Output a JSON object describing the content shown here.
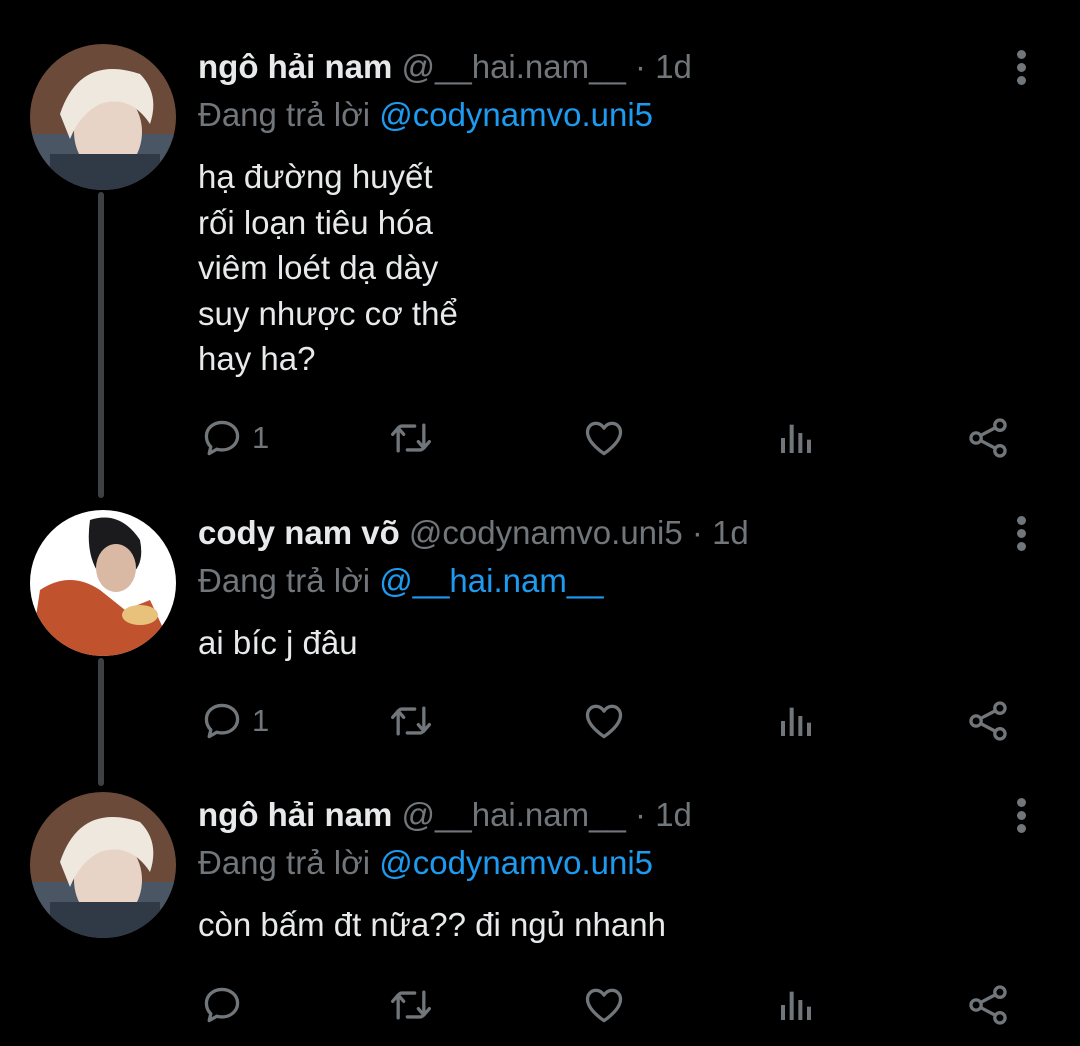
{
  "tweets": [
    {
      "name": "ngô hải nam",
      "handle": "@__hai.nam__",
      "separator": "·",
      "time": "1d",
      "replying_prefix": "Đang trả lời",
      "replying_to": "@codynamvo.uni5",
      "lines": [
        "hạ đường huyết",
        "rối loạn tiêu hóa",
        "viêm loét dạ dày",
        "suy nhược cơ thể",
        "hay ha?"
      ],
      "reply_count": "1",
      "avatar": "blond-hair-man-avatar"
    },
    {
      "name": "cody nam võ",
      "handle": "@codynamvo.uni5",
      "separator": "·",
      "time": "1d",
      "replying_prefix": "Đang trả lời",
      "replying_to": "@__hai.nam__",
      "lines": [
        "ai bíc j đâu"
      ],
      "reply_count": "1",
      "avatar": "dark-hair-man-eating-avatar"
    },
    {
      "name": "ngô hải nam",
      "handle": "@__hai.nam__",
      "separator": "·",
      "time": "1d",
      "replying_prefix": "Đang trả lời",
      "replying_to": "@codynamvo.uni5",
      "lines": [
        "còn bấm đt nữa?? đi ngủ nhanh"
      ],
      "reply_count": "",
      "avatar": "blond-hair-man-avatar"
    }
  ],
  "icons": {
    "reply": "reply-icon",
    "retweet": "retweet-icon",
    "like": "heart-icon",
    "views": "views-icon",
    "share": "share-icon",
    "more": "more-vertical-icon"
  },
  "colors": {
    "background": "#000000",
    "text": "#e7e9ea",
    "muted": "#71767b",
    "link": "#1d9bf0",
    "thread_line": "#3e4144"
  }
}
